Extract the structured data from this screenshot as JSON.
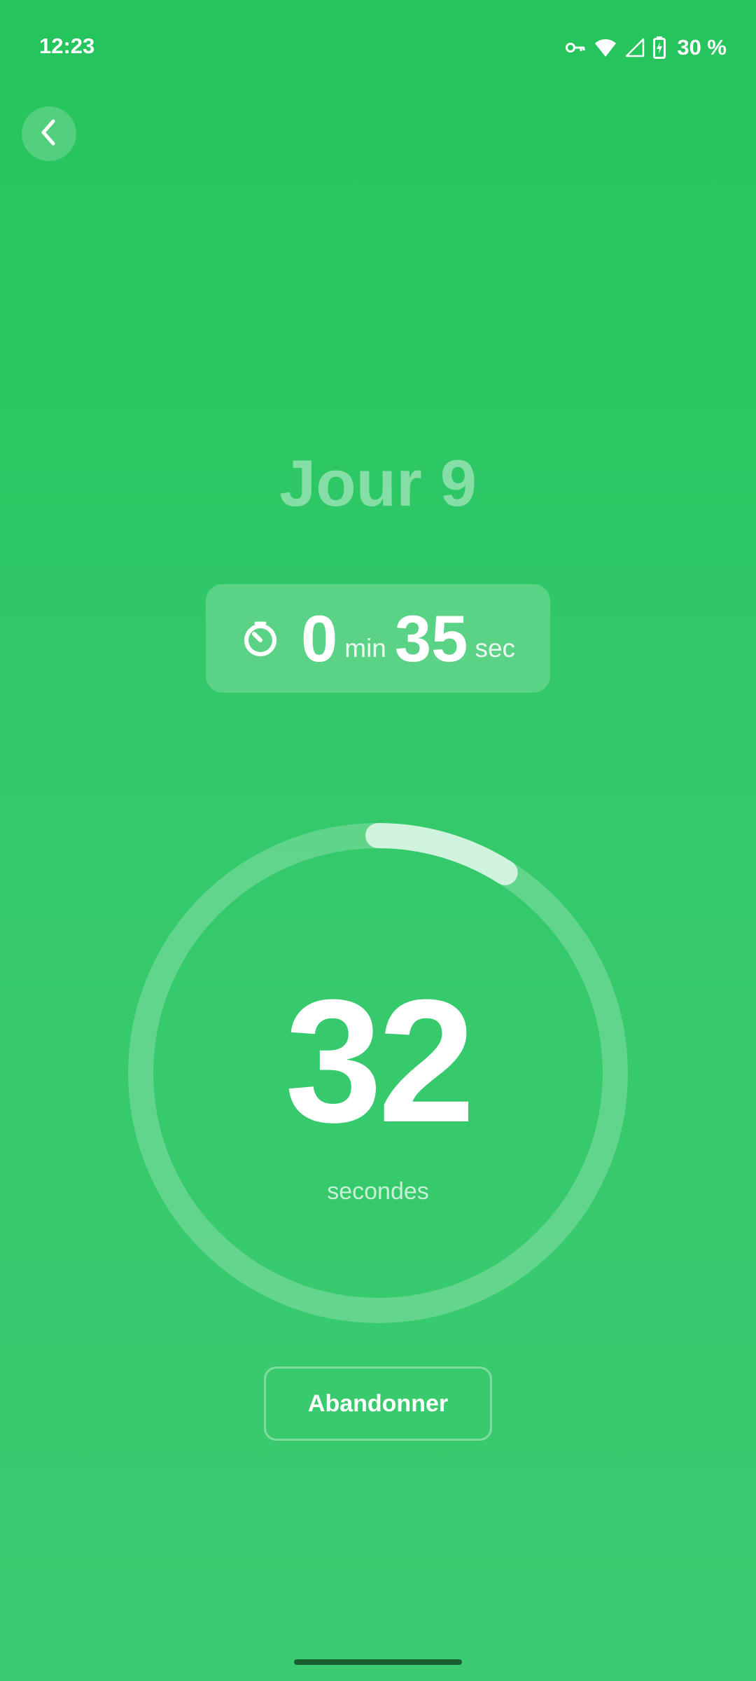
{
  "status_bar": {
    "time": "12:23",
    "battery": "30 %",
    "icons": [
      "vpn-key-icon",
      "wifi-icon",
      "signal-icon",
      "battery-charging-icon"
    ]
  },
  "back_button": {
    "icon": "chevron-left-icon"
  },
  "day_title": "Jour 9",
  "total_time": {
    "icon": "timer-icon",
    "minutes": "0",
    "minutes_unit": "min",
    "seconds": "35",
    "seconds_unit": "sec"
  },
  "countdown": {
    "value": "32",
    "unit": "secondes",
    "progress_fraction": 0.09
  },
  "abandon_button": {
    "label": "Abandonner"
  },
  "colors": {
    "background_top": "#25c45c",
    "background_bottom": "#3ccb70",
    "ring_track": "rgba(255,255,255,0.22)",
    "ring_progress": "rgba(255,255,255,0.7)"
  }
}
